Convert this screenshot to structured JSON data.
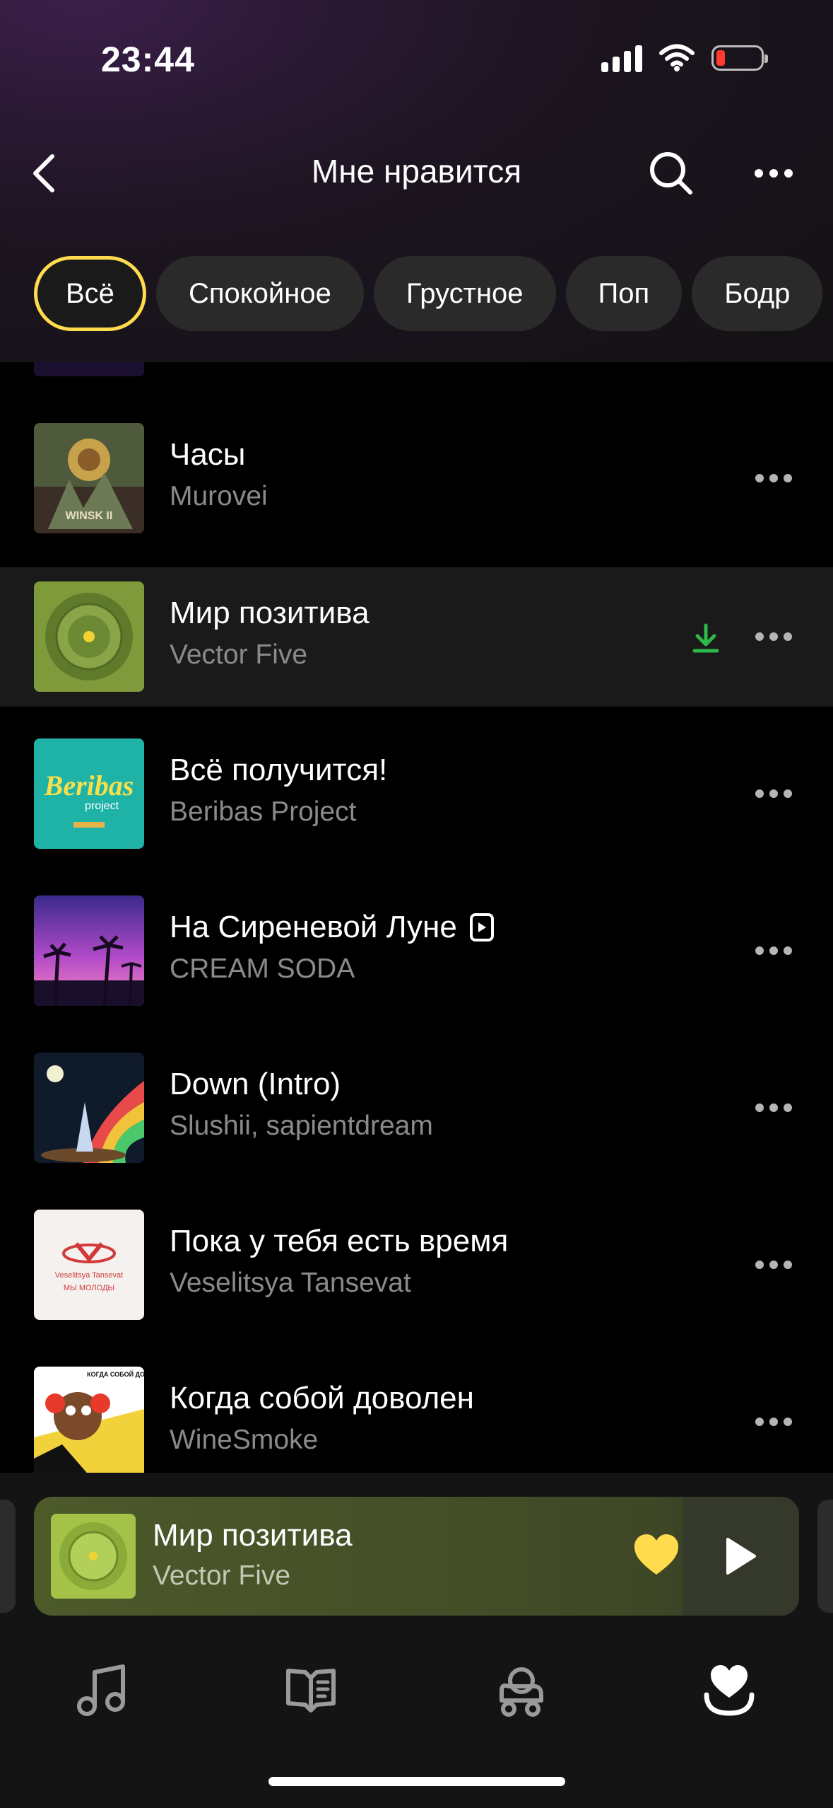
{
  "status_bar": {
    "time": "23:44"
  },
  "header": {
    "title": "Мне нравится"
  },
  "chips": [
    "Всё",
    "Спокойное",
    "Грустное",
    "Поп",
    "Бодр"
  ],
  "tracks": [
    {
      "title": "Часы",
      "artist": "Murovei",
      "downloaded": false,
      "video": false
    },
    {
      "title": "Мир позитива",
      "artist": "Vector Five",
      "downloaded": true,
      "video": false
    },
    {
      "title": "Всё получится!",
      "artist": "Beribas Project",
      "downloaded": false,
      "video": false
    },
    {
      "title": "На Сиреневой Луне",
      "artist": "CREAM SODA",
      "downloaded": false,
      "video": true
    },
    {
      "title": "Down (Intro)",
      "artist": "Slushii, sapientdream",
      "downloaded": false,
      "video": false
    },
    {
      "title": "Пока у тебя есть время",
      "artist": "Veselitsya Tansevat",
      "downloaded": false,
      "video": false
    },
    {
      "title": "Когда собой доволен",
      "artist": "WineSmoke",
      "downloaded": false,
      "video": false
    }
  ],
  "covers": {
    "winsk": "WINSK II",
    "beribas": "Beribas",
    "beribas_sub": "project",
    "veselitsya": "Veselitsya Tansevat",
    "veselitsya_sub": "МЫ МОЛОДЫ",
    "winesmoke": "КОГДА СОБОЙ ДОВОЛЕН"
  },
  "now_playing": {
    "title": "Мир позитива",
    "artist": "Vector Five",
    "liked": true
  },
  "colors": {
    "accent": "#ffdb4d",
    "download": "#2db84a"
  }
}
